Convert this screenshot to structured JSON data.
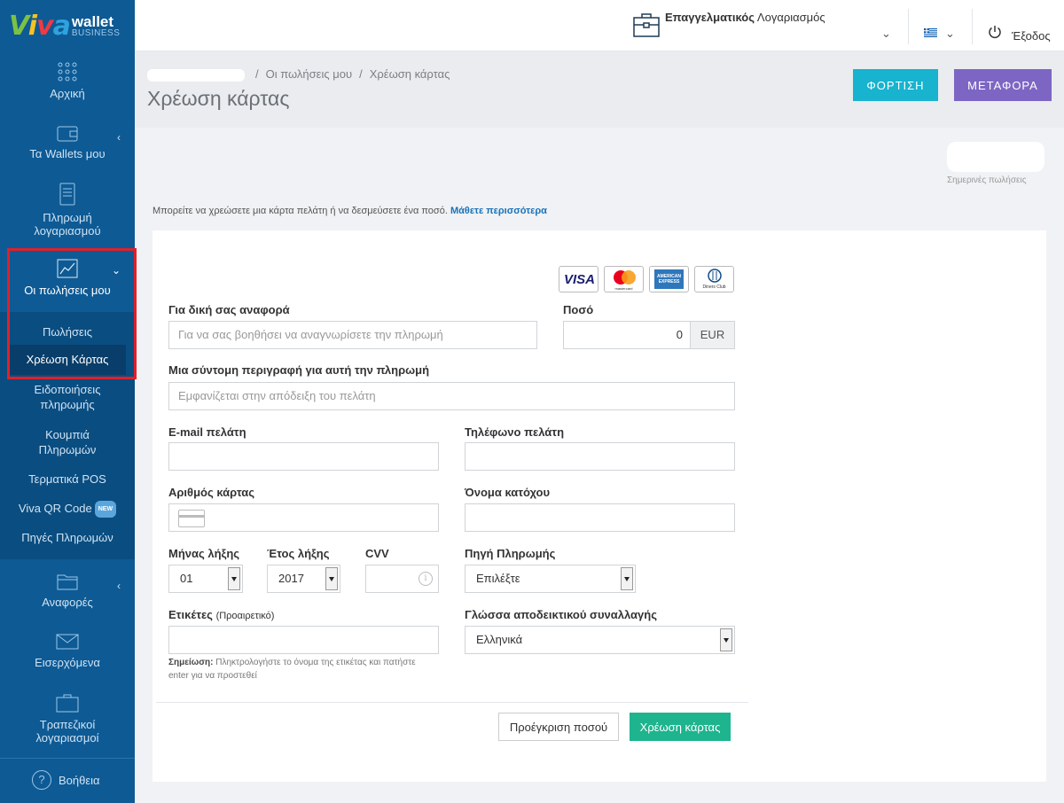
{
  "logo": {
    "viva": "Viva",
    "wallet": "wallet",
    "business": "BUSINESS"
  },
  "sidebar": {
    "items": [
      {
        "label": "Αρχική",
        "icon": "grid-icon"
      },
      {
        "label": "Τα Wallets μου",
        "icon": "wallet-icon"
      },
      {
        "label": "Πληρωμή λογαριασμού",
        "icon": "bill-icon"
      },
      {
        "label": "Οι πωλήσεις μου",
        "icon": "chart-icon"
      },
      {
        "label": "Αναφορές",
        "icon": "folder-icon"
      },
      {
        "label": "Εισερχόμενα",
        "icon": "envelope-icon"
      },
      {
        "label": "Τραπεζικοί λογαριασμοί",
        "icon": "briefcase-icon"
      },
      {
        "label": "Βοήθεια",
        "icon": "help-icon"
      }
    ],
    "sub_items": [
      {
        "label": "Πωλήσεις"
      },
      {
        "label": "Χρέωση Κάρτας"
      },
      {
        "label": "Ειδοποιήσεις πληρωμής"
      },
      {
        "label": "Κουμπιά Πληρωμών"
      },
      {
        "label": "Τερματικά POS"
      },
      {
        "label": "Viva QR Code",
        "badge": "NEW"
      },
      {
        "label": "Πηγές Πληρωμών"
      }
    ],
    "highlight_color": "#e0202a"
  },
  "topbar": {
    "account_bold": "Επαγγελματικός",
    "account_rest": "Λογαριασμός",
    "logout": "Έξοδος"
  },
  "header": {
    "breadcrumb": [
      "Οι πωλήσεις μου",
      "Χρέωση κάρτας"
    ],
    "title": "Χρέωση κάρτας",
    "charge_button": "ΦΟΡΤΙΣΗ",
    "transfer_button": "ΜΕΤΑΦΟΡΑ"
  },
  "sales_label": "Σημερινές πωλήσεις",
  "intro": {
    "text": "Μπορείτε να χρεώσετε μια κάρτα πελάτη ή να δεσμεύσετε ένα ποσό.",
    "link": "Μάθετε περισσότερα"
  },
  "form": {
    "card_brands": [
      "VISA",
      "mastercard",
      "AMERICAN EXPRESS",
      "Diners Club"
    ],
    "reference": {
      "label": "Για δική σας αναφορά",
      "placeholder": "Για να σας βοηθήσει να αναγνωρίσετε την πληρωμή"
    },
    "amount": {
      "label": "Ποσό",
      "value": "0",
      "currency": "EUR"
    },
    "description": {
      "label": "Μια σύντομη περιγραφή για αυτή την πληρωμή",
      "placeholder": "Εμφανίζεται στην απόδειξη του πελάτη"
    },
    "email": {
      "label": "E-mail πελάτη"
    },
    "phone": {
      "label": "Τηλέφωνο πελάτη"
    },
    "card_number": {
      "label": "Αριθμός κάρτας"
    },
    "holder": {
      "label": "Όνομα κατόχου"
    },
    "exp_month": {
      "label": "Μήνας λήξης",
      "value": "01"
    },
    "exp_year": {
      "label": "Έτος λήξης",
      "value": "2017"
    },
    "cvv": {
      "label": "CVV"
    },
    "source": {
      "label": "Πηγή Πληρωμής",
      "value": "Επιλέξτε"
    },
    "tags": {
      "label": "Ετικέτες",
      "optional": "(Προαιρετικό)"
    },
    "language": {
      "label": "Γλώσσα αποδεικτικού συναλλαγής",
      "value": "Ελληνικά"
    },
    "note_bold": "Σημείωση:",
    "note_text": "Πληκτρολογήστε το όνομα της ετικέτας και πατήστε enter για να προστεθεί",
    "preauth_button": "Προέγκριση ποσού",
    "submit_button": "Χρέωση κάρτας"
  }
}
